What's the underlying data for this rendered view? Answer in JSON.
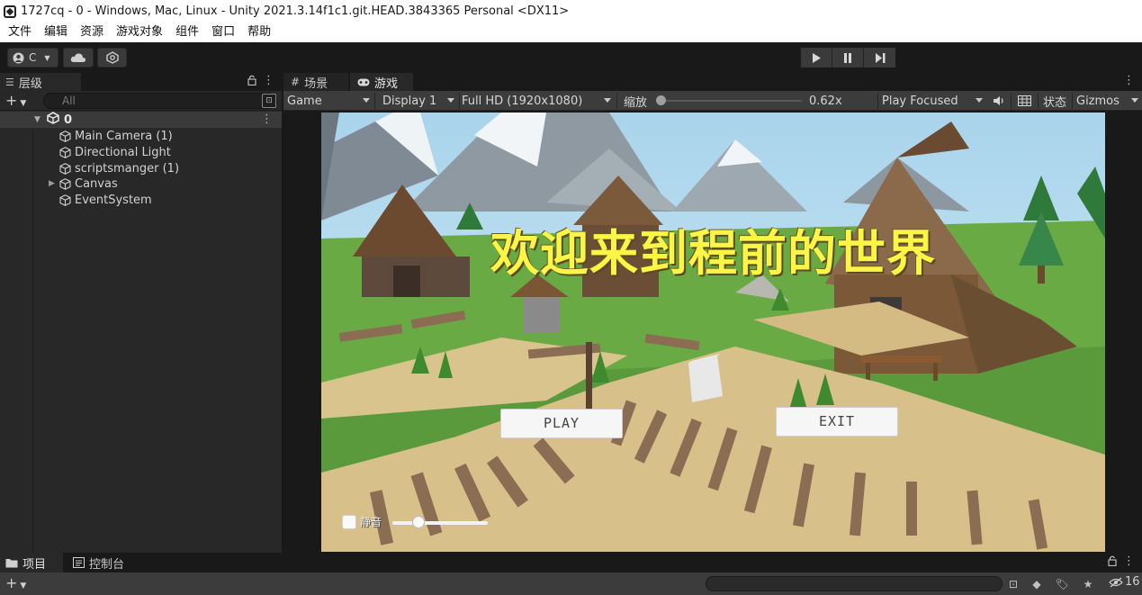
{
  "window": {
    "title": "1727cq - 0 - Windows, Mac, Linux - Unity 2021.3.14f1c1.git.HEAD.3843365 Personal <DX11>"
  },
  "menu": [
    "文件",
    "编辑",
    "资源",
    "游戏对象",
    "组件",
    "窗口",
    "帮助"
  ],
  "toolbar": {
    "account_label": "C"
  },
  "hierarchy": {
    "tab_label": "层级",
    "search_placeholder": "All",
    "scene_name": "0",
    "items": [
      {
        "label": "Main Camera (1)"
      },
      {
        "label": "Directional Light"
      },
      {
        "label": "scriptsmanger (1)"
      },
      {
        "label": "Canvas"
      },
      {
        "label": "EventSystem"
      }
    ]
  },
  "game_view": {
    "tabs": [
      {
        "label": "场景"
      },
      {
        "label": "游戏"
      }
    ],
    "mode": "Game",
    "display": "Display 1",
    "resolution": "Full HD (1920x1080)",
    "scale_label": "缩放",
    "scale_value": "0.62x",
    "scale_fraction": 0.02,
    "play_mode": "Play Focused",
    "stats_label": "状态",
    "gizmos_label": "Gizmos"
  },
  "game_ui": {
    "title": "欢迎来到程前的世界",
    "play_button": "PLAY",
    "exit_button": "EXIT",
    "mute_label": "静音",
    "volume_fraction": 0.27,
    "title_color": "#fbf545"
  },
  "project": {
    "tabs": [
      {
        "label": "项目"
      },
      {
        "label": "控制台"
      }
    ],
    "hidden_count": "16"
  },
  "icons": [
    "unity-logo-icon",
    "account-icon",
    "cloud-icon",
    "collab-icon",
    "play-icon",
    "pause-icon",
    "step-icon",
    "lock-icon",
    "kebab-icon",
    "search-icon",
    "cube-icon",
    "audio-icon",
    "grid-icon",
    "folder-icon",
    "console-icon",
    "eye-hidden-icon",
    "star-icon",
    "tag-icon"
  ]
}
